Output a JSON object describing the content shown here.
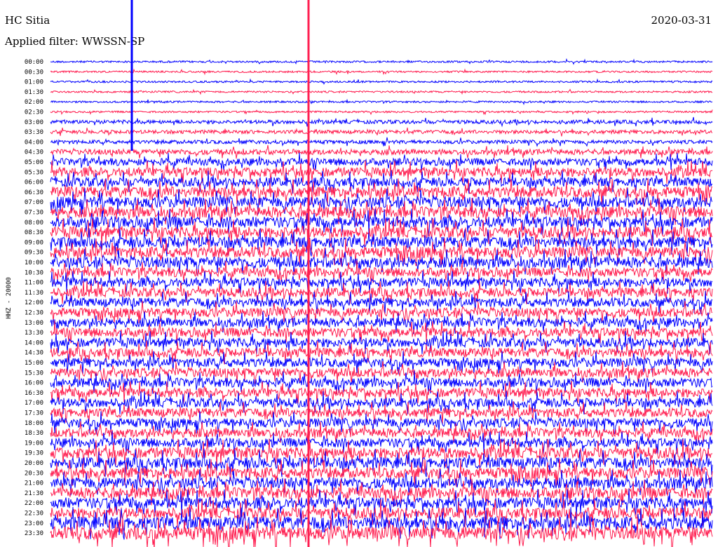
{
  "header": {
    "station": "HC Sitia",
    "date": "2020-03-31",
    "filter": "Applied filter: WWSSN-SP"
  },
  "chart_data": {
    "type": "line",
    "ylabel": "HHZ - 20000",
    "colors": [
      "#0000ff",
      "#ff1e50"
    ],
    "grid": false,
    "rows": [
      {
        "label": "00:00",
        "color": "#0000ff",
        "energy": 1
      },
      {
        "label": "00:30",
        "color": "#ff1e50",
        "energy": 1
      },
      {
        "label": "01:00",
        "color": "#0000ff",
        "energy": 1
      },
      {
        "label": "01:30",
        "color": "#ff1e50",
        "energy": 1
      },
      {
        "label": "02:00",
        "color": "#0000ff",
        "energy": 1
      },
      {
        "label": "02:30",
        "color": "#ff1e50",
        "energy": 1
      },
      {
        "label": "03:00",
        "color": "#0000ff",
        "energy": 2
      },
      {
        "label": "03:30",
        "color": "#ff1e50",
        "energy": 2
      },
      {
        "label": "04:00",
        "color": "#0000ff",
        "energy": 2
      },
      {
        "label": "04:30",
        "color": "#ff1e50",
        "energy": 3
      },
      {
        "label": "05:00",
        "color": "#0000ff",
        "energy": 4
      },
      {
        "label": "05:30",
        "color": "#ff1e50",
        "energy": 5
      },
      {
        "label": "06:00",
        "color": "#0000ff",
        "energy": 5
      },
      {
        "label": "06:30",
        "color": "#ff1e50",
        "energy": 6
      },
      {
        "label": "07:00",
        "color": "#0000ff",
        "energy": 6
      },
      {
        "label": "07:30",
        "color": "#ff1e50",
        "energy": 6
      },
      {
        "label": "08:00",
        "color": "#0000ff",
        "energy": 6
      },
      {
        "label": "08:30",
        "color": "#ff1e50",
        "energy": 6
      },
      {
        "label": "09:00",
        "color": "#0000ff",
        "energy": 6
      },
      {
        "label": "09:30",
        "color": "#ff1e50",
        "energy": 6
      },
      {
        "label": "10:00",
        "color": "#0000ff",
        "energy": 6
      },
      {
        "label": "10:30",
        "color": "#ff1e50",
        "energy": 5
      },
      {
        "label": "11:00",
        "color": "#0000ff",
        "energy": 5
      },
      {
        "label": "11:30",
        "color": "#ff1e50",
        "energy": 5
      },
      {
        "label": "12:00",
        "color": "#0000ff",
        "energy": 5
      },
      {
        "label": "12:30",
        "color": "#ff1e50",
        "energy": 5
      },
      {
        "label": "13:00",
        "color": "#0000ff",
        "energy": 5
      },
      {
        "label": "13:30",
        "color": "#ff1e50",
        "energy": 5
      },
      {
        "label": "14:00",
        "color": "#0000ff",
        "energy": 5
      },
      {
        "label": "14:30",
        "color": "#ff1e50",
        "energy": 5
      },
      {
        "label": "15:00",
        "color": "#0000ff",
        "energy": 5
      },
      {
        "label": "15:30",
        "color": "#ff1e50",
        "energy": 5
      },
      {
        "label": "16:00",
        "color": "#0000ff",
        "energy": 5
      },
      {
        "label": "16:30",
        "color": "#ff1e50",
        "energy": 5
      },
      {
        "label": "17:00",
        "color": "#0000ff",
        "energy": 5
      },
      {
        "label": "17:30",
        "color": "#ff1e50",
        "energy": 5
      },
      {
        "label": "18:00",
        "color": "#0000ff",
        "energy": 5
      },
      {
        "label": "18:30",
        "color": "#ff1e50",
        "energy": 5
      },
      {
        "label": "19:00",
        "color": "#0000ff",
        "energy": 5
      },
      {
        "label": "19:30",
        "color": "#ff1e50",
        "energy": 6
      },
      {
        "label": "20:00",
        "color": "#0000ff",
        "energy": 6
      },
      {
        "label": "20:30",
        "color": "#ff1e50",
        "energy": 6
      },
      {
        "label": "21:00",
        "color": "#0000ff",
        "energy": 6
      },
      {
        "label": "21:30",
        "color": "#ff1e50",
        "energy": 6
      },
      {
        "label": "22:00",
        "color": "#0000ff",
        "energy": 6
      },
      {
        "label": "22:30",
        "color": "#ff1e50",
        "energy": 6
      },
      {
        "label": "23:00",
        "color": "#0000ff",
        "energy": 7
      },
      {
        "label": "23:30",
        "color": "#ff1e50",
        "energy": 7
      }
    ]
  }
}
